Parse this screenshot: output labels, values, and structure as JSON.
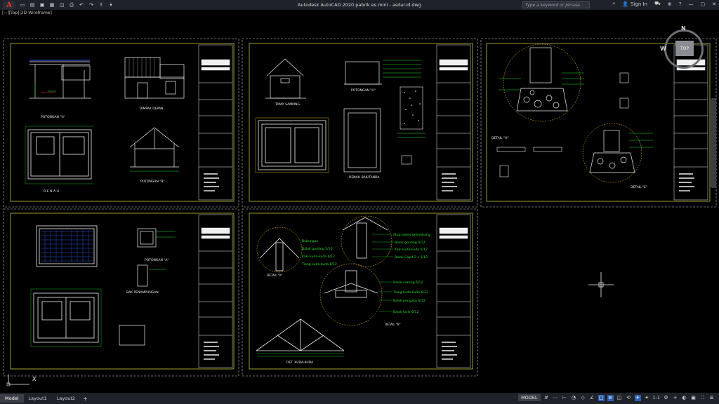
{
  "titlebar": {
    "app_icon": "A",
    "title": "Autodesk AutoCAD 2020   pabrik es mini - asdar.id.dwg",
    "search_placeholder": "Type a keyword or phrase",
    "sign_in": "Sign In"
  },
  "viewport": {
    "label": "[−][Top][2D Wireframe]"
  },
  "viewcube": {
    "face": "TOP",
    "north": "N",
    "west": "W"
  },
  "sheets": {
    "s1": {
      "potongan_h": "POTONGAN \"H\"",
      "tampak_depan": "TAMPAK DEPAN",
      "denah": "D E N A H",
      "potongan_b": "POTONGAN \"B\""
    },
    "s2": {
      "tampak_samping": "TAMP. SAMPING",
      "potongan_h2": "POTONGAN \"H\"",
      "denah_bak": "DENAH BAK/TANDA"
    },
    "s3": {
      "detail_h": "DETAIL \"H\"",
      "detail_e": "DETAIL \"E\""
    },
    "s4": {
      "potongan_a": "POTONGAN \"A\"",
      "bak_penampungan": "BAK PENAMPUNGAN"
    },
    "s5": {
      "labels": [
        "Atap asbes gelombang",
        "Balok gording 6/12",
        "Kaki kuda-kuda 6/12",
        "Balok Gapit 2 x 5/10",
        "Bubungan",
        "Balok gording 5/10",
        "Kaki kuda-kuda 6/12",
        "Tiang kuda-kuda 6/12",
        "Balok sokong 6/12",
        "Tiang kuda-kuda 6/12",
        "Balok pengaku 6/12",
        "Balok tarik 6/12"
      ],
      "detail_a": "DETAIL \"A\"",
      "detail_b": "DETAIL \"B\"",
      "det_kuda": "DET. KUDA-KUDA"
    }
  },
  "statusbar": {
    "tabs": [
      "Model",
      "Layout1",
      "Layout2"
    ],
    "model_label": "MODEL",
    "scale": "1:1"
  },
  "colors": {
    "background": "#000000",
    "sheet_border": "#c8c43a",
    "green": "#22e022",
    "white": "#f0f0f0",
    "cyan": "#22d6e0",
    "blue": "#2a4fd8"
  }
}
